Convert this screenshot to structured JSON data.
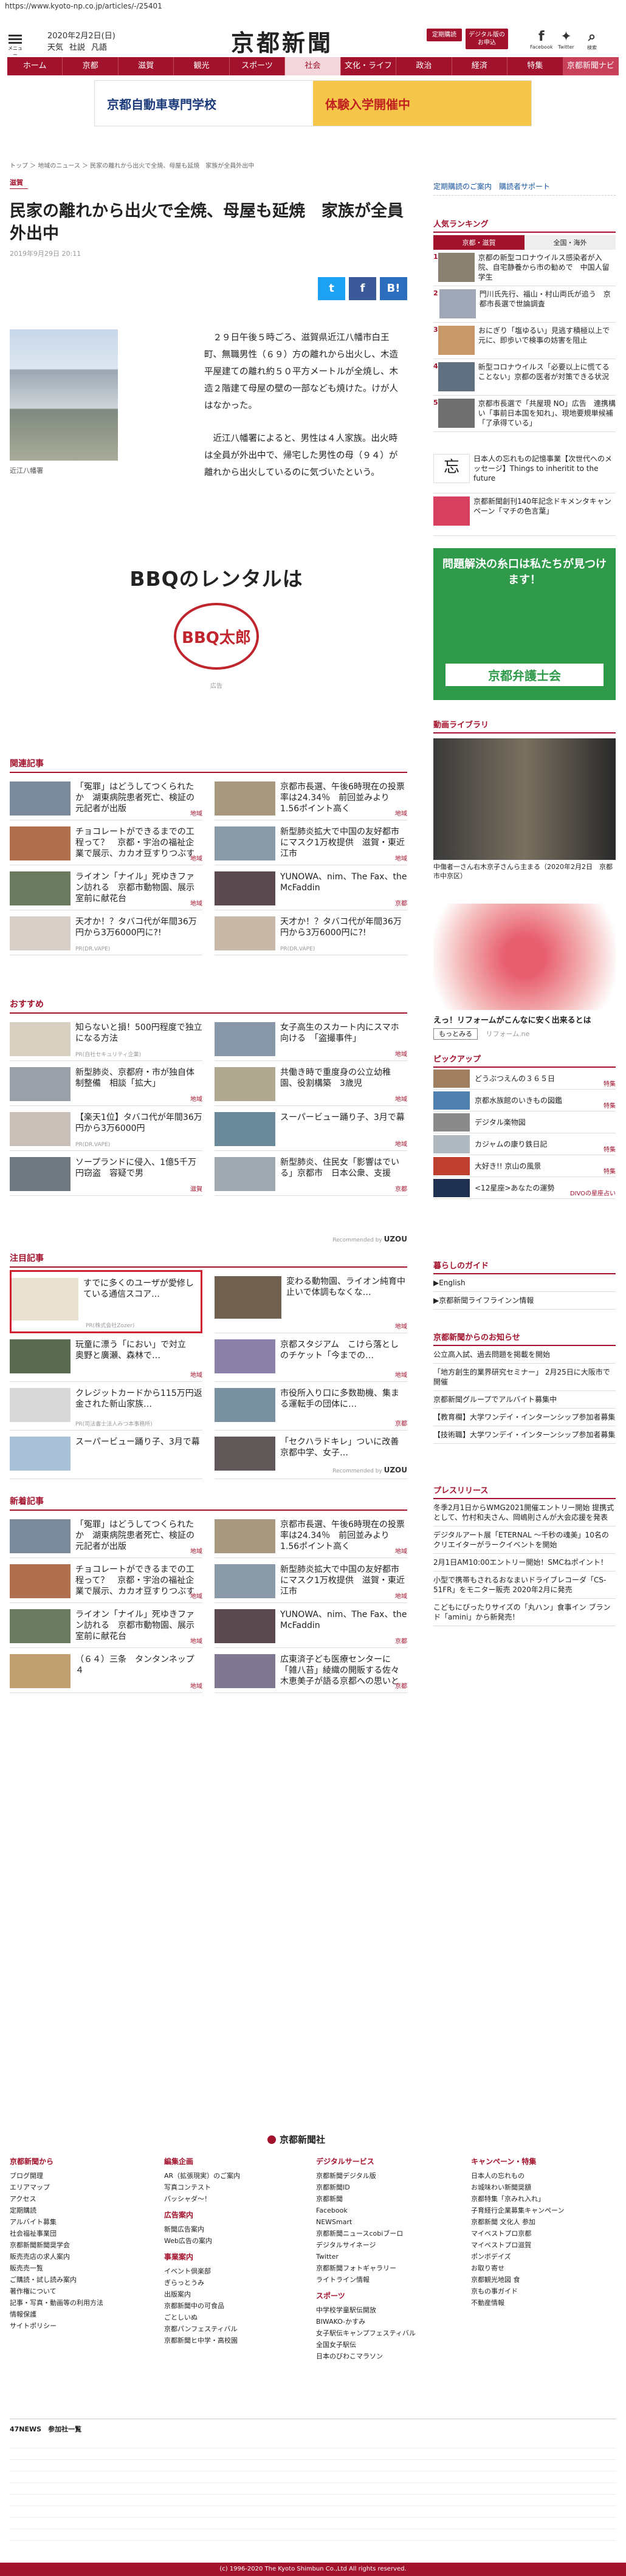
{
  "url": "https://www.kyoto-np.co.jp/articles/-/25401",
  "header": {
    "menu": "メニュー",
    "date": "2020年2月2日(日)",
    "links": [
      "天気",
      "社説",
      "凡語"
    ],
    "logo": "京都新聞",
    "btn1": "定期購読",
    "btn2": "デジタル版のお申込",
    "fb": "Facebook",
    "tw": "Twitter",
    "search": "検索"
  },
  "nav": [
    "ホーム",
    "京都",
    "滋賀",
    "観光",
    "スポーツ",
    "社会",
    "文化・ライフ",
    "政治",
    "経済",
    "特集",
    "京都新聞ナビ"
  ],
  "banner": {
    "left": "京都自動車専門学校",
    "right": "体験入学開催中"
  },
  "crumb": "トップ ＞ 地域のニュース ＞ 民家の離れから出火で全焼、母屋も延焼　家族が全員外出中",
  "article": {
    "cat": "滋賀",
    "title": "民家の離れから出火で全焼、母屋も延焼　家族が全員外出中",
    "date": "2019年9月29日 20:11",
    "caption": "近江八幡署",
    "p1": "２９日午後５時ごろ、滋賀県近江八幡市白王町、無職男性（６９）方の離れから出火し、木造平屋建ての離れ約５０平方メートルが全焼し、木造２階建て母屋の壁の一部なども焼けた。けが人はなかった。",
    "p2": "近江八幡署によると、男性は４人家族。出火時は全員が外出中で、帰宅した男性の母（９４）が離れから出火しているのに気づいたという。"
  },
  "share": {
    "tw": "t",
    "fb": "f",
    "hb": "B!"
  },
  "ad": {
    "title": "BBQのレンタルは",
    "logo": "BBQ太郎",
    "small": "広告"
  },
  "sections": {
    "related": "関連記事",
    "recommend": "おすすめ",
    "featured": "注目記事",
    "latest": "新着記事"
  },
  "related": [
    {
      "t": "「冤罪」はどうしてつくられたか　湖東病院患者死亡、検証の元記者が出版",
      "g": "地域"
    },
    {
      "t": "京都市長選、午後6時現在の投票率は24.34％　前回並みより1.56ポイント高く",
      "g": "地域"
    },
    {
      "t": "チョコレートができるまでの工程って？　京都・宇治の福祉企業で展示、カカオ豆すりつぶす体験も",
      "g": "地域"
    },
    {
      "t": "新型肺炎拡大で中国の友好都市にマスク1万枚提供　滋賀・東近江市",
      "g": "地域"
    },
    {
      "t": "ライオン「ナイル」死ゆきファン訪れる　京都市動物園、展示室前に献花台",
      "g": "地域"
    },
    {
      "t": "YUNOWA、nim、The Fax、the McFaddin",
      "g": "京都"
    },
    {
      "t": "天才か！？タバコ代が年間36万円から3万6000円に?!",
      "p": "PR(DR.VAPE)"
    },
    {
      "t": "天才か！？タバコ代が年間36万円から3万6000円に?!",
      "p": "PR(DR.VAPE)"
    }
  ],
  "recommend": [
    {
      "t": "知らないと損！500円程度で独立になる方法",
      "p": "PR(自社セキュリティ企業)"
    },
    {
      "t": "女子高生のスカート内にスマホ向ける　「盗撮事件」",
      "g": "地域"
    },
    {
      "t": "新型肺炎、京都府・市が独自体制整備　相談「拡大」",
      "g": "地域"
    },
    {
      "t": "共働き時で重度身の公立幼稚園、役割構築　3歳児",
      "g": "地域"
    },
    {
      "t": "【楽天1位】タバコ代が年間36万円から3万6000円",
      "p": "PR(DR.VAPE)"
    },
    {
      "t": "スーパービュー踊り子、3月で幕",
      "g": "地域"
    },
    {
      "t": "ソープランドに侵入、1億5千万円窃盗　容疑で男",
      "g": "滋賀"
    },
    {
      "t": "新型肺炎、住民女「影響はでいる」京都市　日本公衆、支援",
      "g": "京都"
    }
  ],
  "recommended_by": "Recommended by",
  "uzou": "UZOU",
  "featured": [
    {
      "t": "すでに多くのユーザが愛修している通信スコア…",
      "p": "PR(株式会社Zozer)"
    },
    {
      "t": "変わる動物園、ライオン純育中止いで体調もなくな…",
      "g": "地域"
    },
    {
      "t": "玩童に漂う「におい」で対立　奥野と廣瀬、森林で…",
      "g": "地域"
    },
    {
      "t": "京都スタジアム　こけら落としのチケット「今までの…",
      "g": "地域"
    },
    {
      "t": "クレジットカードから115万円返金された新山家族…",
      "p": "PR(司法書士法人みつ本事務所)"
    },
    {
      "t": "市役所入り口に多数勘機、集まる運転手の団体に…",
      "g": "京都"
    },
    {
      "t": "スーパービュー踊り子、3月で幕",
      "g": ""
    },
    {
      "t": "「セクハラドキレ」ついに改善　京都中学、女子…",
      "g": ""
    }
  ],
  "latest": [
    {
      "t": "「冤罪」はどうしてつくられたか　湖東病院患者死亡、検証の元記者が出版",
      "g": "地域"
    },
    {
      "t": "京都市長選、午後6時現在の投票率は24.34％　前回並みより1.56ポイント高く",
      "g": "地域"
    },
    {
      "t": "チョコレートができるまでの工程って？　京都・宇治の福祉企業で展示、カカオ豆すりつぶす体験も",
      "g": "地域"
    },
    {
      "t": "新型肺炎拡大で中国の友好都市にマスク1万枚提供　滋賀・東近江市",
      "g": "地域"
    },
    {
      "t": "ライオン「ナイル」死ゆきファン訪れる　京都市動物園、展示室前に献花台",
      "g": "地域"
    },
    {
      "t": "YUNOWA、nim、The Fax、the McFaddin",
      "g": "京都"
    },
    {
      "t": "（６４）三条　タンタンネップ４",
      "g": "地域"
    },
    {
      "t": "広東済子ども医療センターに「雑八苔」綾織の開販する佐々木恵美子が語る京都への思いとは",
      "g": "京都"
    }
  ],
  "side": {
    "links": [
      "定期購読のご案内",
      "購読者サポート"
    ],
    "rank": "人気ランキング",
    "tabs": [
      "京都・滋賀",
      "全国・海外"
    ],
    "ranks": [
      "京都の新型コロナウイルス感染者が入院、自宅静養から市の勧めで　中国人留学生",
      "門川氏先行、福山・村山両氏が追う　京都市長選で世論調査",
      "おにぎり「塩ゆるい」見逃す積極以上で元に、即歩いで検事の妨害を阻止",
      "新型コロナウイルス「必要以上に慌てることない」京都の医者が対策できる状況",
      "京都市長選で「共屋現 NO」広告　連携構い「事前日本国を知れ」、現地要規単候補「了承得ている」"
    ],
    "pr1": "日本人の忘れもの記憶事業【次世代へのメッセージ】Things to inheritit to the future",
    "pr2": "京都新聞創刊140年記念ドキメンタキャンペーン「マチの色言葉」",
    "pr": "PR",
    "ad2": {
      "top": "問題解決の糸口は私たちが見つけます！",
      "name": "京都弁護士会"
    },
    "video": "動画ライブラリ",
    "video_caption": "中傷者一さん右木京子さんら主まる（2020年2月2日　京都市中京区）",
    "ad3": {
      "title": "えっ！リフォームがこんなに安く出来るとは",
      "btn": "もっとみる",
      "src": "リフォーム.ne"
    },
    "pickup": "ピックアップ",
    "picks": [
      {
        "t": "どうぶつえんの３６５日",
        "g": "特集"
      },
      {
        "t": "京都水族館のいきもの図鑑",
        "g": "特集"
      },
      {
        "t": "デジタル楽物図",
        "g": ""
      },
      {
        "t": "カジャムの康り鉄日記",
        "g": "特集"
      },
      {
        "t": "大好き!! 京山の風景",
        "g": "特集"
      },
      {
        "t": "<12星座>あなたの運勢",
        "g": "DIVOの星座占い"
      }
    ],
    "guide": "暮らしのガイド",
    "guides": [
      "▶English",
      "▶京都新聞ライフラインン情報"
    ],
    "notice": "京都新聞からのお知らせ",
    "notices": [
      "公立高入試、過去問題を掲載を開始",
      "「地方創生的業界研究セミナー」 2月25日に大阪市で開催",
      "京都新聞グループでアルバイト募集中",
      "【教育欄】大学ワンデイ・インターンシップ参加者募集",
      "【技術職】大学ワンデイ・インターンシップ参加者募集"
    ],
    "press": "プレスリリース",
    "presses": [
      "冬季2月1日からWMG2021開催エントリー開始 提携式として、竹村和夫さん、岡嶋則さんが大会応援を発表",
      "デジタルアート展「ETERNAL ～千秒の魂美」10名のクリエイターがラークイベントを開始",
      "2月1日AM10:00エントリー開始！SMCねポイント！",
      "小型で携帯もされるおなまいドライブレコーダ「CS-51FR」をモニター販売 2020年2月に発売",
      "こどもにぴったりサイズの「丸ハン」食事イン ブランド「amini」から新発売！"
    ]
  },
  "footer": {
    "logo": "京都新聞社",
    "cols": [
      {
        "h": "京都新聞から",
        "i": [
          "ブログ開理",
          "エリアマップ",
          "アクセス",
          "定期購読",
          "アルバイト募集",
          "社会福祉事業団",
          "京都新聞新聞奨学会",
          "販売売店の求人案内",
          "販売売一覧",
          "ご購読・試し読み案内",
          "著作権について",
          "記事・写真・動画等の利用方法",
          "情報保護",
          "サイトポリシー"
        ]
      },
      {
        "h": "編集企画",
        "i": [
          "AR（拡張現実）のご案内",
          "写真コンテスト",
          "パッシャダ～！"
        ]
      },
      {
        "h": "広告案内",
        "i": [
          "新聞広告案内",
          "Web広告の案内"
        ]
      },
      {
        "h": "事業案内",
        "i": [
          "イベント倶楽部",
          "ぎらっとうみ",
          "出版案内",
          "京都新聞中の可食品",
          "ごとしいぬ",
          "京都パンフェスティバル",
          "京都新聞ヒ中学・高校園"
        ]
      },
      {
        "h": "デジタルサービス",
        "i": [
          "京都新聞デジタル版",
          "京都新聞ID",
          "京都新聞",
          "Facebook",
          "NEWSmart",
          "京都新聞ニュースcobiブーロ",
          "デジタルサイネージ",
          "Twitter",
          "京都新聞フォトギャラリー",
          "ライトライン情報"
        ]
      },
      {
        "h": "スポーツ",
        "i": [
          "中学校学童駅伝開放",
          "BIWAKO-かすみ",
          "女子駅伝キャンプフェスティバル",
          "全国女子駅伝",
          "日本のびわこマラソン"
        ]
      },
      {
        "h": "キャンペーン・特集",
        "i": [
          "日本人の忘れもの",
          "お城味わい新聞奨額",
          "京都特集「京みれ入れ」",
          "子育経行企業募集キャンペーン",
          "京都新聞 文化人 参加",
          "マイベストプロ京都",
          "マイベストプロ滋賀",
          "ポンボデイズ",
          "お取り寄せ",
          "京都観光地図 食",
          "京もの事ガイド",
          "不動産情報"
        ]
      }
    ],
    "bottom": "47NEWS　参加社一覧",
    "copy": "(c) 1996-2020 The Kyoto Shimbun Co.,Ltd All rights reserved."
  }
}
